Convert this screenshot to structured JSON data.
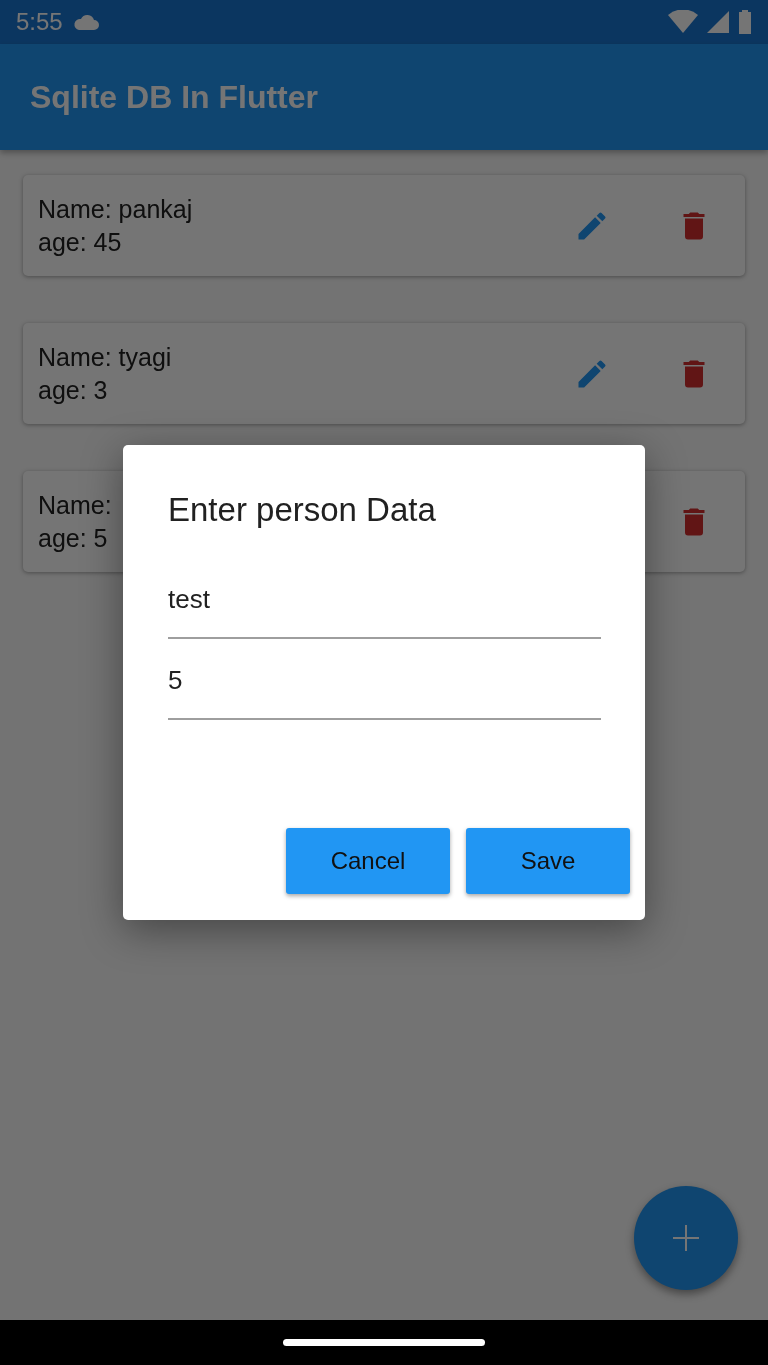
{
  "status_bar": {
    "time": "5:55"
  },
  "app_bar": {
    "title": "Sqlite DB In Flutter"
  },
  "people": [
    {
      "name_line": "Name: pankaj",
      "age_line": "age: 45",
      "edit_visible": true
    },
    {
      "name_line": "Name: tyagi",
      "age_line": "age: 3",
      "edit_visible": true
    },
    {
      "name_line": "Name:",
      "age_line": "age: 5",
      "edit_visible": false
    }
  ],
  "dialog": {
    "title": "Enter person Data",
    "fields": [
      {
        "value": "test"
      },
      {
        "value": "5"
      }
    ],
    "buttons": [
      "Cancel",
      "Save"
    ]
  }
}
